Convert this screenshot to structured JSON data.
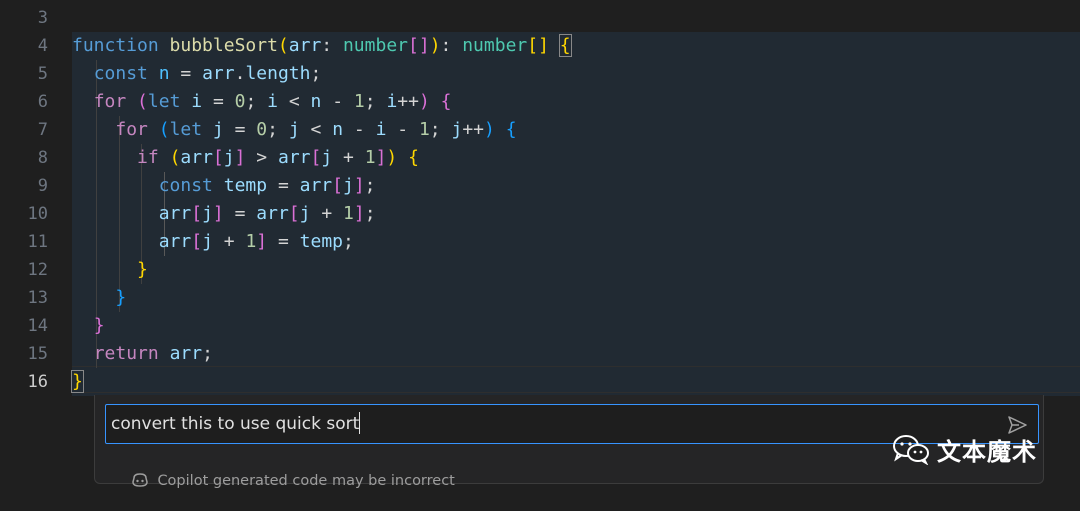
{
  "editor": {
    "line_numbers": [
      "3",
      "4",
      "5",
      "6",
      "7",
      "8",
      "9",
      "10",
      "11",
      "12",
      "13",
      "14",
      "15",
      "16"
    ],
    "active_line": "16",
    "code_lines": [
      "",
      "function bubbleSort(arr: number[]): number[] {",
      "  const n = arr.length;",
      "  for (let i = 0; i < n - 1; i++) {",
      "    for (let j = 0; j < n - i - 1; j++) {",
      "      if (arr[j] > arr[j + 1]) {",
      "        const temp = arr[j];",
      "        arr[j] = arr[j + 1];",
      "        arr[j + 1] = temp;",
      "      }",
      "    }",
      "  }",
      "  return arr;",
      "}"
    ],
    "syntax_colors": {
      "keyword": "#569cd6",
      "control": "#c586c0",
      "function": "#dcdcaa",
      "type": "#4ec9b0",
      "variable": "#9cdcfe",
      "constant": "#4fc1ff",
      "number": "#b5cea8",
      "bracket_level1": "#ffd700",
      "bracket_level2": "#da70d6",
      "bracket_level3": "#179fff"
    }
  },
  "chat": {
    "input_value": "convert this to use quick sort",
    "disclaimer": "Copilot generated code may be incorrect",
    "accent_color": "#3794ff",
    "icons": {
      "send": "send-icon",
      "copilot": "copilot-icon"
    }
  },
  "watermark": {
    "text": "文本魔术",
    "icon": "wechat-icon"
  }
}
